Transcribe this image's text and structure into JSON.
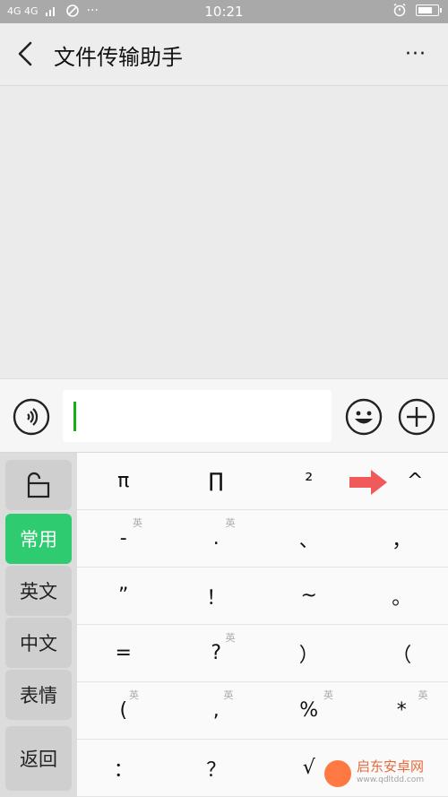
{
  "status_bar": {
    "network": "4G 4G",
    "time": "10:21",
    "icons": [
      "signal-icon",
      "no-disturb-icon",
      "more-dots-icon",
      "alarm-icon",
      "battery-icon"
    ]
  },
  "header": {
    "title": "文件传输助手",
    "more": "···"
  },
  "input": {
    "value": ""
  },
  "keyboard": {
    "side": {
      "lock_icon": "unlock-icon",
      "items": [
        {
          "label": "常用",
          "active": true
        },
        {
          "label": "英文",
          "active": false
        },
        {
          "label": "中文",
          "active": false
        },
        {
          "label": "表情",
          "active": false
        }
      ],
      "back": "返回"
    },
    "rows": [
      [
        {
          "k": "π"
        },
        {
          "k": "∏"
        },
        {
          "k": "²"
        },
        {
          "k": "^"
        }
      ],
      [
        {
          "k": "-",
          "tag": "英"
        },
        {
          "k": ".",
          "tag": "英"
        },
        {
          "k": "、"
        },
        {
          "k": "，"
        }
      ],
      [
        {
          "k": "”"
        },
        {
          "k": "！"
        },
        {
          "k": "~"
        },
        {
          "k": "。"
        }
      ],
      [
        {
          "k": "="
        },
        {
          "k": "?",
          "tag": "英"
        },
        {
          "k": "）"
        },
        {
          "k": "（"
        }
      ],
      [
        {
          "k": "(",
          "tag": "英"
        },
        {
          "k": ",",
          "tag": "英"
        },
        {
          "k": "%",
          "tag": "英"
        },
        {
          "k": "*",
          "tag": "英"
        }
      ],
      [
        {
          "k": "："
        },
        {
          "k": "？"
        },
        {
          "k": "√"
        },
        {
          "k": ""
        }
      ]
    ]
  },
  "watermark": {
    "name": "启东安卓网",
    "url": "www.qdltdd.com"
  },
  "colors": {
    "accent": "#2fcb71",
    "cursor": "#1aad19",
    "arrow": "#f05a5a"
  }
}
